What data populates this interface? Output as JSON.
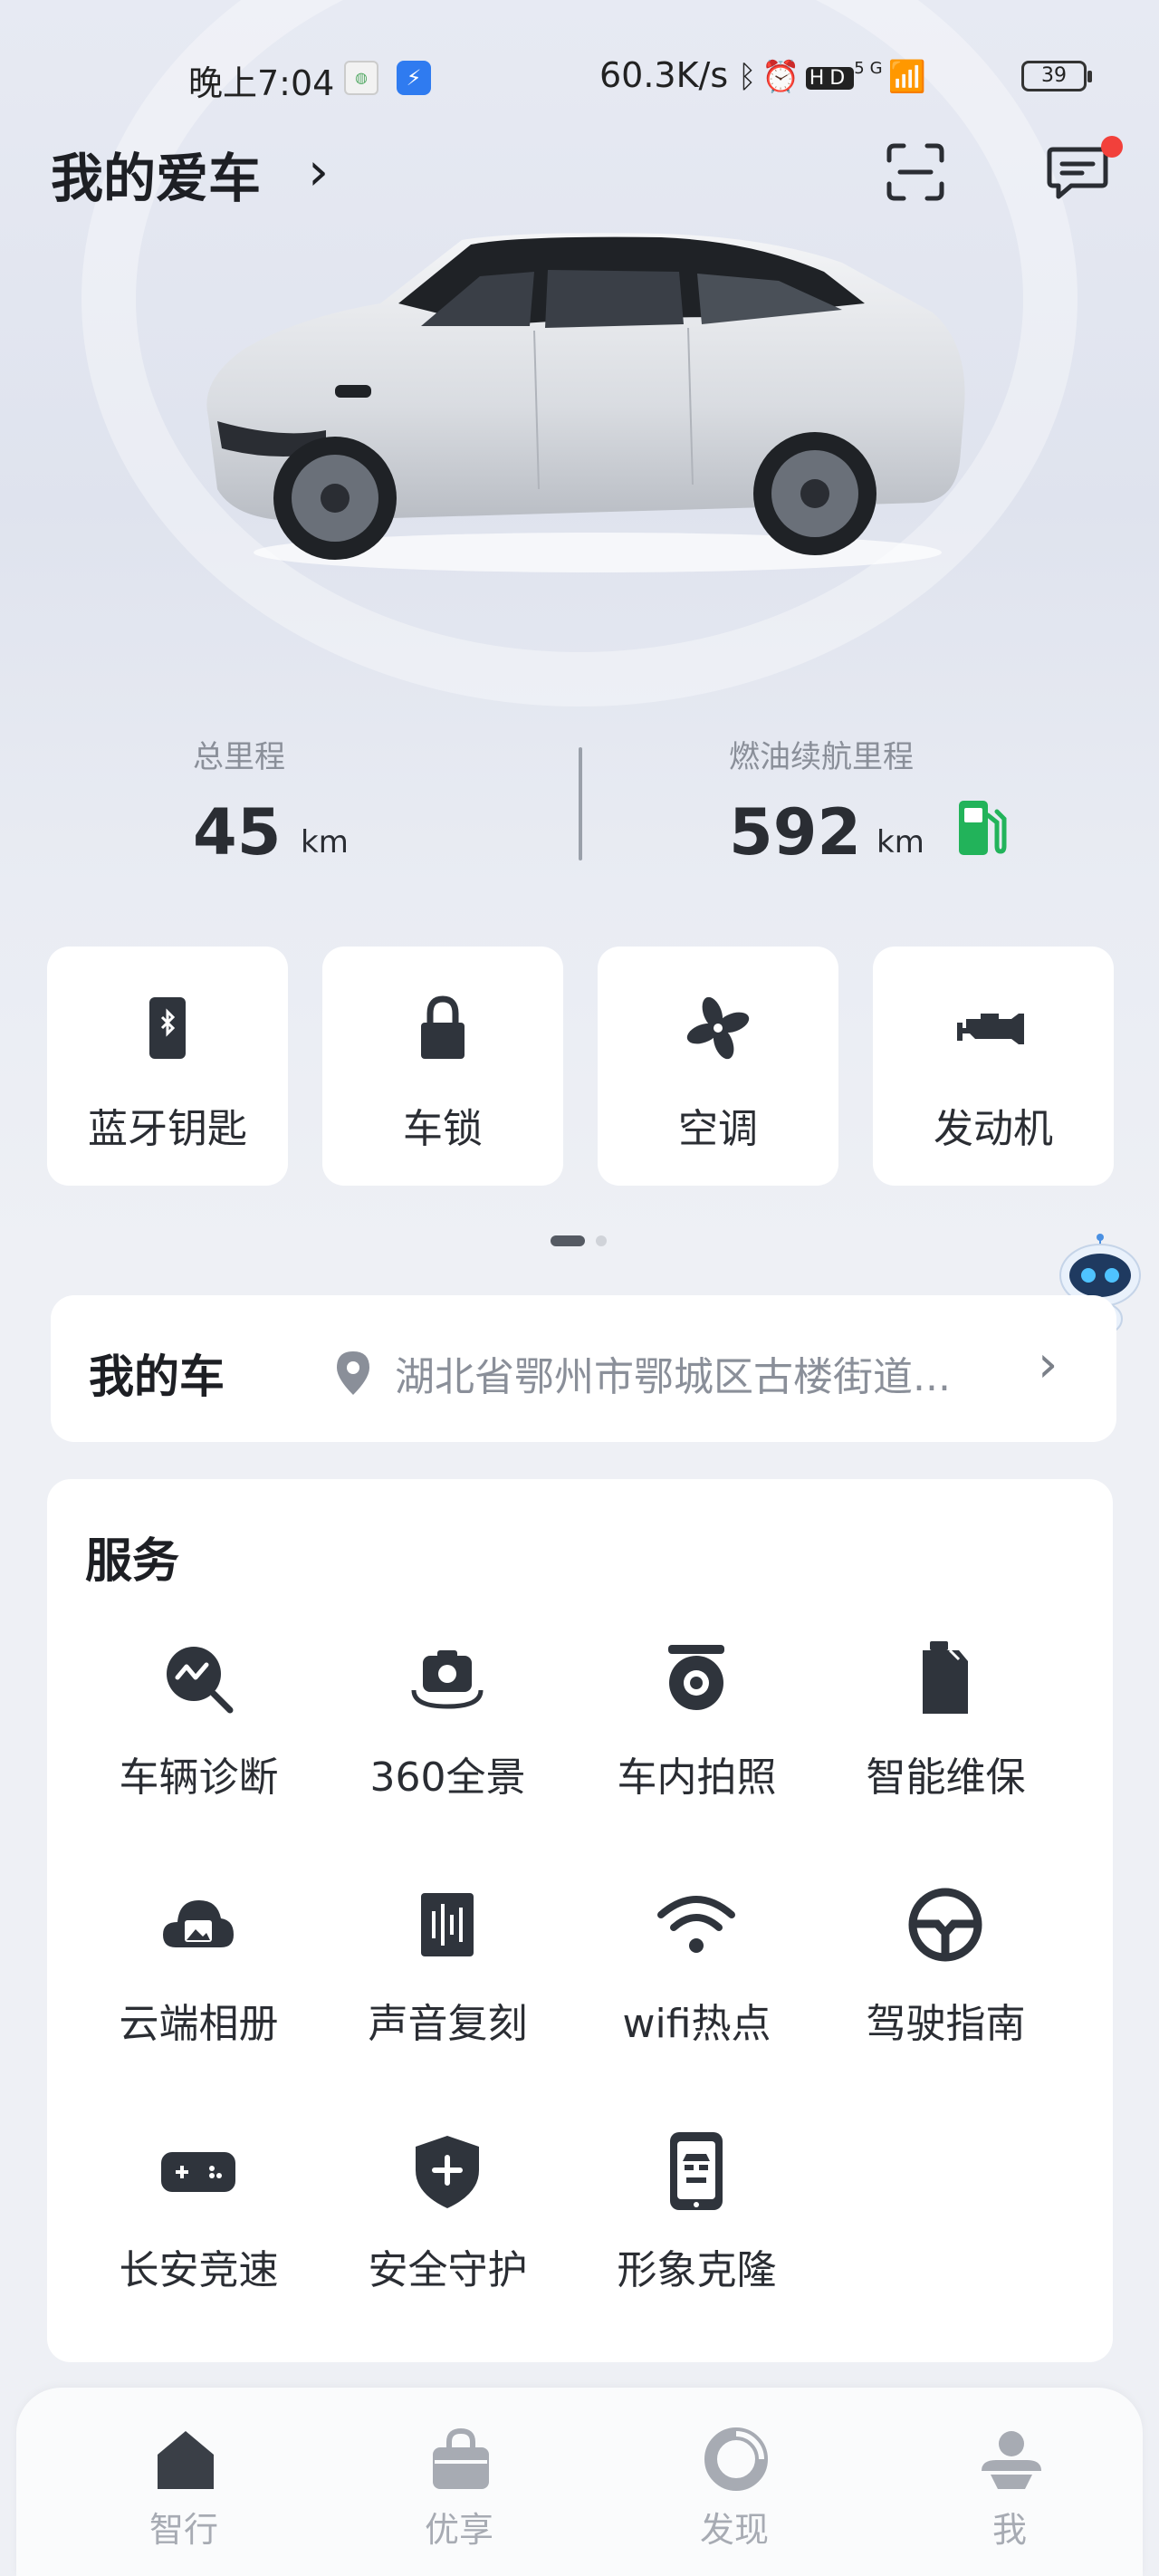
{
  "status_bar": {
    "time": "晚上7:04",
    "network_speed": "60.3K/s",
    "network_type": "5G",
    "battery": "39"
  },
  "header": {
    "title": "我的爱车"
  },
  "mileage": {
    "total_label": "总里程",
    "total_value": "45",
    "total_unit": "km",
    "range_label": "燃油续航里程",
    "range_value": "592",
    "range_unit": "km"
  },
  "quick_controls": [
    {
      "label": "蓝牙钥匙",
      "icon": "bluetooth-key-icon"
    },
    {
      "label": "车锁",
      "icon": "lock-icon"
    },
    {
      "label": "空调",
      "icon": "fan-icon"
    },
    {
      "label": "发动机",
      "icon": "engine-icon"
    }
  ],
  "pager": {
    "pages": 2,
    "active": 1
  },
  "my_car": {
    "title": "我的车",
    "address": "湖北省鄂州市鄂城区古楼街道..."
  },
  "services": {
    "title": "服务",
    "items": [
      {
        "label": "车辆诊断",
        "icon": "diagnosis-icon"
      },
      {
        "label": "360全景",
        "icon": "panorama-camera-icon"
      },
      {
        "label": "车内拍照",
        "icon": "in-car-camera-icon"
      },
      {
        "label": "智能维保",
        "icon": "maintenance-icon"
      },
      {
        "label": "云端相册",
        "icon": "cloud-album-icon"
      },
      {
        "label": "声音复刻",
        "icon": "voice-clone-icon"
      },
      {
        "label": "wifi热点",
        "icon": "wifi-icon"
      },
      {
        "label": "驾驶指南",
        "icon": "steering-wheel-icon"
      },
      {
        "label": "长安竞速",
        "icon": "gamepad-icon"
      },
      {
        "label": "安全守护",
        "icon": "shield-icon"
      },
      {
        "label": "形象克隆",
        "icon": "avatar-clone-icon"
      }
    ]
  },
  "bottom_nav": [
    {
      "label": "智行",
      "icon": "home-icon",
      "active": true
    },
    {
      "label": "优享",
      "icon": "bag-icon"
    },
    {
      "label": "发现",
      "icon": "discover-icon"
    },
    {
      "label": "我",
      "icon": "profile-icon"
    }
  ],
  "colors": {
    "accent_green": "#22b35a",
    "notification_red": "#f2403b",
    "icon_dark": "#2f343c",
    "nav_inactive": "#a7abb3"
  }
}
